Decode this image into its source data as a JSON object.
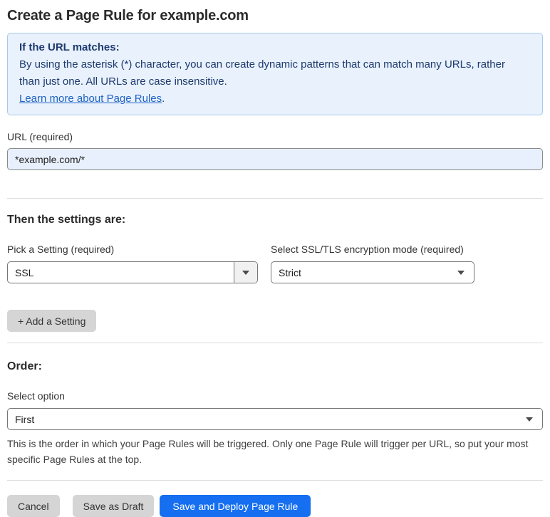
{
  "page": {
    "title": "Create a Page Rule for example.com"
  },
  "info_box": {
    "heading": "If the URL matches:",
    "body": "By using the asterisk (*) character, you can create dynamic patterns that can match many URLs, rather than just one. All URLs are case insensitive.",
    "link_label": "Learn more about Page Rules",
    "link_suffix": "."
  },
  "url_field": {
    "label": "URL (required)",
    "value": "*example.com/*"
  },
  "settings_section": {
    "heading": "Then the settings are:",
    "setting_picker": {
      "label": "Pick a Setting (required)",
      "value": "SSL"
    },
    "ssl_mode": {
      "label": "Select SSL/TLS encryption mode (required)",
      "value": "Strict"
    },
    "add_setting_label": "+ Add a Setting"
  },
  "order_section": {
    "heading": "Order:",
    "select_label": "Select option",
    "value": "First",
    "help_text": "This is the order in which your Page Rules will be triggered. Only one Page Rule will trigger per URL, so put your most specific Page Rules at the top."
  },
  "footer": {
    "cancel_label": "Cancel",
    "save_draft_label": "Save as Draft",
    "save_deploy_label": "Save and Deploy Page Rule"
  },
  "colors": {
    "info_box_bg": "#e8f1fc",
    "info_box_border": "#a9c9ea",
    "info_text": "#1e3a6e",
    "link": "#2163c4",
    "input_filled_bg": "#e7f0fc",
    "control_border": "#767676",
    "gray_button_bg": "#d5d5d5",
    "primary_button_bg": "#156ff0",
    "primary_button_text": "#ffffff"
  }
}
